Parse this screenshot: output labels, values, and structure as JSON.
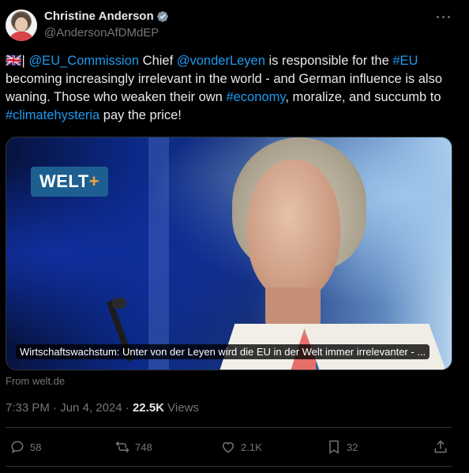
{
  "author": {
    "name": "Christine Anderson",
    "handle": "@AndersonAfDMdEP"
  },
  "tweet": {
    "flag": "🇬🇧|",
    "mention1": "@EU_Commission",
    "t1": " Chief ",
    "mention2": "@vonderLeyen",
    "t2": " is responsible for the ",
    "hashtag1": "#EU",
    "t3": " becoming increasingly irrelevant in the world - and German influence is also waning. Those who weaken their own ",
    "hashtag2": "#economy",
    "t4": ", moralize, and succumb to ",
    "hashtag3": "#climatehysteria",
    "t5": " pay the price!"
  },
  "card": {
    "logo_text": "WELT",
    "logo_plus": "+",
    "caption": "Wirtschaftswachstum: Unter von der Leyen wird die EU in der Welt immer irrelevanter - ...",
    "source": "From welt.de"
  },
  "meta": {
    "time": "7:33 PM",
    "sep": " · ",
    "date": "Jun 4, 2024",
    "views_num": "22.5K",
    "views_label": " Views"
  },
  "actions": {
    "replies": "58",
    "reposts": "748",
    "likes": "2.1K",
    "bookmarks": "32"
  },
  "colors": {
    "link": "#1d9bf0",
    "muted": "#71767b",
    "text": "#e7e9ea",
    "background": "#000000"
  }
}
